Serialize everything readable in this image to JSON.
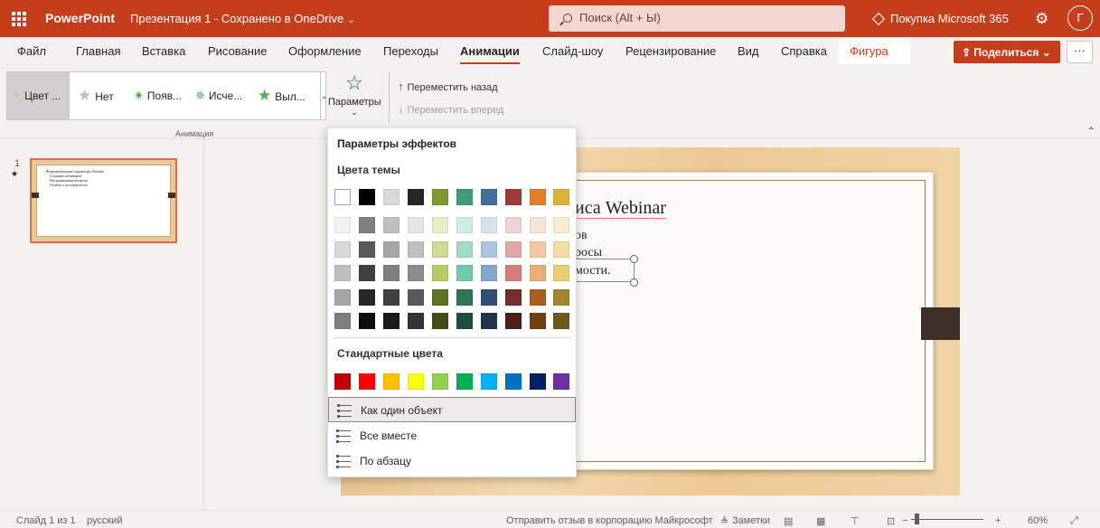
{
  "topbar": {
    "app_name": "PowerPoint",
    "doc_title": "Презентация 1  -  Сохранено в OneDrive",
    "search_placeholder": "Поиск (Alt + Ы)",
    "buy_label": "Покупка Microsoft 365",
    "avatar_initial": "Г",
    "brand_color": "#c43e1c"
  },
  "tabs": [
    {
      "label": "Файл"
    },
    {
      "label": "Главная"
    },
    {
      "label": "Вставка"
    },
    {
      "label": "Рисование"
    },
    {
      "label": "Оформление"
    },
    {
      "label": "Переходы"
    },
    {
      "label": "Анимации",
      "active": true
    },
    {
      "label": "Слайд-шоу"
    },
    {
      "label": "Рецензирование"
    },
    {
      "label": "Вид"
    },
    {
      "label": "Справка"
    },
    {
      "label": "Фигура"
    }
  ],
  "share_label": "Поделиться",
  "more_label": "···",
  "ribbon": {
    "gallery": [
      {
        "label": "Цвет ...",
        "selected": true
      },
      {
        "label": "Нет"
      },
      {
        "label": "Появ..."
      },
      {
        "label": "Исче..."
      },
      {
        "label": "Выл..."
      }
    ],
    "params_label": "Параметры",
    "move_back": "Переместить назад",
    "move_forward": "Переместить вперед",
    "group_label": "Анимация"
  },
  "thumbnail": {
    "number": "1",
    "star": "★",
    "title": "Функциональные параметры Webinar",
    "bullets": [
      "Создание вебинаров",
      "Настраиваемые вопросы",
      "Отчёты о посещаемости"
    ]
  },
  "slide": {
    "title": "иса Webinar",
    "lines": [
      "ов",
      "росы",
      "мости."
    ]
  },
  "dropdown": {
    "title": "Параметры эффектов",
    "theme_label": "Цвета темы",
    "standard_label": "Стандартные цвета",
    "theme_top": [
      "#ffffff",
      "#000000",
      "#d9d9d9",
      "#262626",
      "#7f9a2b",
      "#3f9b7a",
      "#416f9c",
      "#9e3b38",
      "#df7f2a",
      "#d9b33b"
    ],
    "theme_shades": [
      [
        "#f2f2f2",
        "#7f7f7f",
        "#bfbfbf",
        "#e6e6e6",
        "#e6efc7",
        "#cfede2",
        "#d6e2ee",
        "#f0d3d2",
        "#f8e4d2",
        "#f7eed0"
      ],
      [
        "#d9d9d9",
        "#595959",
        "#a6a6a6",
        "#bfbfbf",
        "#cddc92",
        "#a1dbc4",
        "#adc4dd",
        "#e2a8a6",
        "#f2c9a5",
        "#f0dda2"
      ],
      [
        "#bfbfbf",
        "#3f3f3f",
        "#7f7f7f",
        "#8c8c8c",
        "#b5cd5e",
        "#74c9a8",
        "#85a7cd",
        "#d37e7a",
        "#eaaf79",
        "#e9cd75"
      ],
      [
        "#a6a6a6",
        "#262626",
        "#404040",
        "#595959",
        "#5e7321",
        "#2f745b",
        "#304f74",
        "#762c2a",
        "#a85e1f",
        "#a2852c"
      ],
      [
        "#7f7f7f",
        "#0d0d0d",
        "#1a1a1a",
        "#333333",
        "#3f4d16",
        "#1f4d3d",
        "#20354d",
        "#4f1d1c",
        "#703f15",
        "#6c591e"
      ]
    ],
    "standard": [
      "#c00000",
      "#ff0000",
      "#ffc000",
      "#ffff00",
      "#92d050",
      "#00b050",
      "#00b0f0",
      "#0070c0",
      "#002060",
      "#7030a0"
    ],
    "options": [
      {
        "label": "Как один объект",
        "hover": true
      },
      {
        "label": "Все вместе"
      },
      {
        "label": "По абзацу"
      }
    ]
  },
  "status": {
    "slide_info": "Слайд 1 из 1",
    "language": "русский",
    "feedback": "Отправить отзыв в корпорацию Майкрософт",
    "notes": "Заметки",
    "zoom": "60%",
    "zoom_minus": "−",
    "zoom_plus": "+"
  }
}
